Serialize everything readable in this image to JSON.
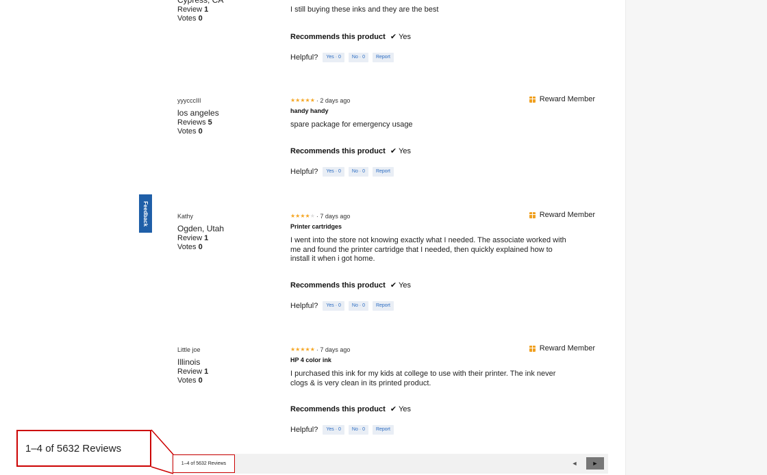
{
  "reviews": [
    {
      "nickname": "",
      "location": "Cypress, CA",
      "review_count_label": "Review",
      "review_count": "1",
      "votes_label": "Votes",
      "votes": "0",
      "stars": 0,
      "stars_text": "",
      "date": "",
      "reward": "",
      "title": "",
      "body": "I still buying these inks and they are the best",
      "recommend_label": "Recommends this product",
      "recommend_mark": "✔",
      "recommend_value": "Yes",
      "helpful_label": "Helpful?",
      "yes_btn": "Yes · 0",
      "no_btn": "No · 0",
      "report_btn": "Report"
    },
    {
      "nickname": "yyycccIII",
      "location": "los angeles",
      "review_count_label": "Reviews",
      "review_count": "5",
      "votes_label": "Votes",
      "votes": "0",
      "stars": 5,
      "stars_text": "★★★★★",
      "date": "· 2 days ago",
      "reward": "Reward Member",
      "title": "handy handy",
      "body": "spare package for emergency usage",
      "recommend_label": "Recommends this product",
      "recommend_mark": "✔",
      "recommend_value": "Yes",
      "helpful_label": "Helpful?",
      "yes_btn": "Yes · 0",
      "no_btn": "No · 0",
      "report_btn": "Report"
    },
    {
      "nickname": "Kathy",
      "location": "Ogden, Utah",
      "review_count_label": "Review",
      "review_count": "1",
      "votes_label": "Votes",
      "votes": "0",
      "stars": 4,
      "stars_text": "★★★★",
      "stars_empty_text": "★",
      "date": "· 7 days ago",
      "reward": "Reward Member",
      "title": "Printer cartridges",
      "body": "I went into the store not knowing exactly what I needed. The associate worked with me and found the printer cartridge that I needed, then quickly explained how to install it when i got home.",
      "recommend_label": "Recommends this product",
      "recommend_mark": "✔",
      "recommend_value": "Yes",
      "helpful_label": "Helpful?",
      "yes_btn": "Yes · 0",
      "no_btn": "No · 0",
      "report_btn": "Report"
    },
    {
      "nickname": "Little joe",
      "location": "Illinois",
      "review_count_label": "Review",
      "review_count": "1",
      "votes_label": "Votes",
      "votes": "0",
      "stars": 5,
      "stars_text": "★★★★★",
      "date": "· 7 days ago",
      "reward": "Reward Member",
      "title": "HP 4 color ink",
      "body": "I purchased this ink for my kids at college to use with their printer. The ink never clogs & is very clean in its printed product.",
      "recommend_label": "Recommends this product",
      "recommend_mark": "✔",
      "recommend_value": "Yes",
      "helpful_label": "Helpful?",
      "yes_btn": "Yes · 0",
      "no_btn": "No · 0",
      "report_btn": "Report"
    }
  ],
  "feedback_tab": "Feedback",
  "pager": {
    "count_text": "1–4 of 5632 Reviews",
    "prev": "◄",
    "next": "►"
  },
  "zoom_callout": "1–4 of 5632 Reviews",
  "colors": {
    "star": "#f5a623",
    "reward_icon": "#f0a020",
    "vote_button_text": "#2a6bc2",
    "feedback_tab": "#1f5fa8",
    "highlight_border": "#cc0000"
  }
}
